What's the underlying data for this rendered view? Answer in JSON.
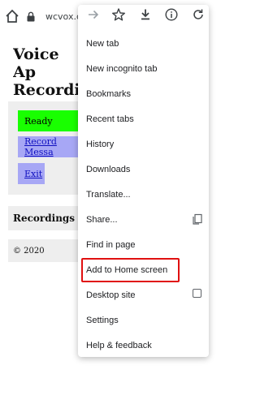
{
  "browser": {
    "url": "wcvox.c"
  },
  "page": {
    "title_line1": "Voice Ap",
    "title_line2": "Recordin",
    "ready_label": "Ready",
    "record_label": "Record Messa",
    "exit_label": "Exit",
    "recordings_label": "Recordings",
    "footer_text": "© 2020"
  },
  "menu": {
    "items": [
      {
        "label": "New tab"
      },
      {
        "label": "New incognito tab"
      },
      {
        "label": "Bookmarks"
      },
      {
        "label": "Recent tabs"
      },
      {
        "label": "History"
      },
      {
        "label": "Downloads"
      },
      {
        "label": "Translate..."
      },
      {
        "label": "Share..."
      },
      {
        "label": "Find in page"
      },
      {
        "label": "Add to Home screen"
      },
      {
        "label": "Desktop site"
      },
      {
        "label": "Settings"
      },
      {
        "label": "Help & feedback"
      }
    ]
  },
  "colors": {
    "ready": "#19ff00",
    "secondary_button": "#a7a7f5",
    "highlight_border": "#e01010"
  }
}
